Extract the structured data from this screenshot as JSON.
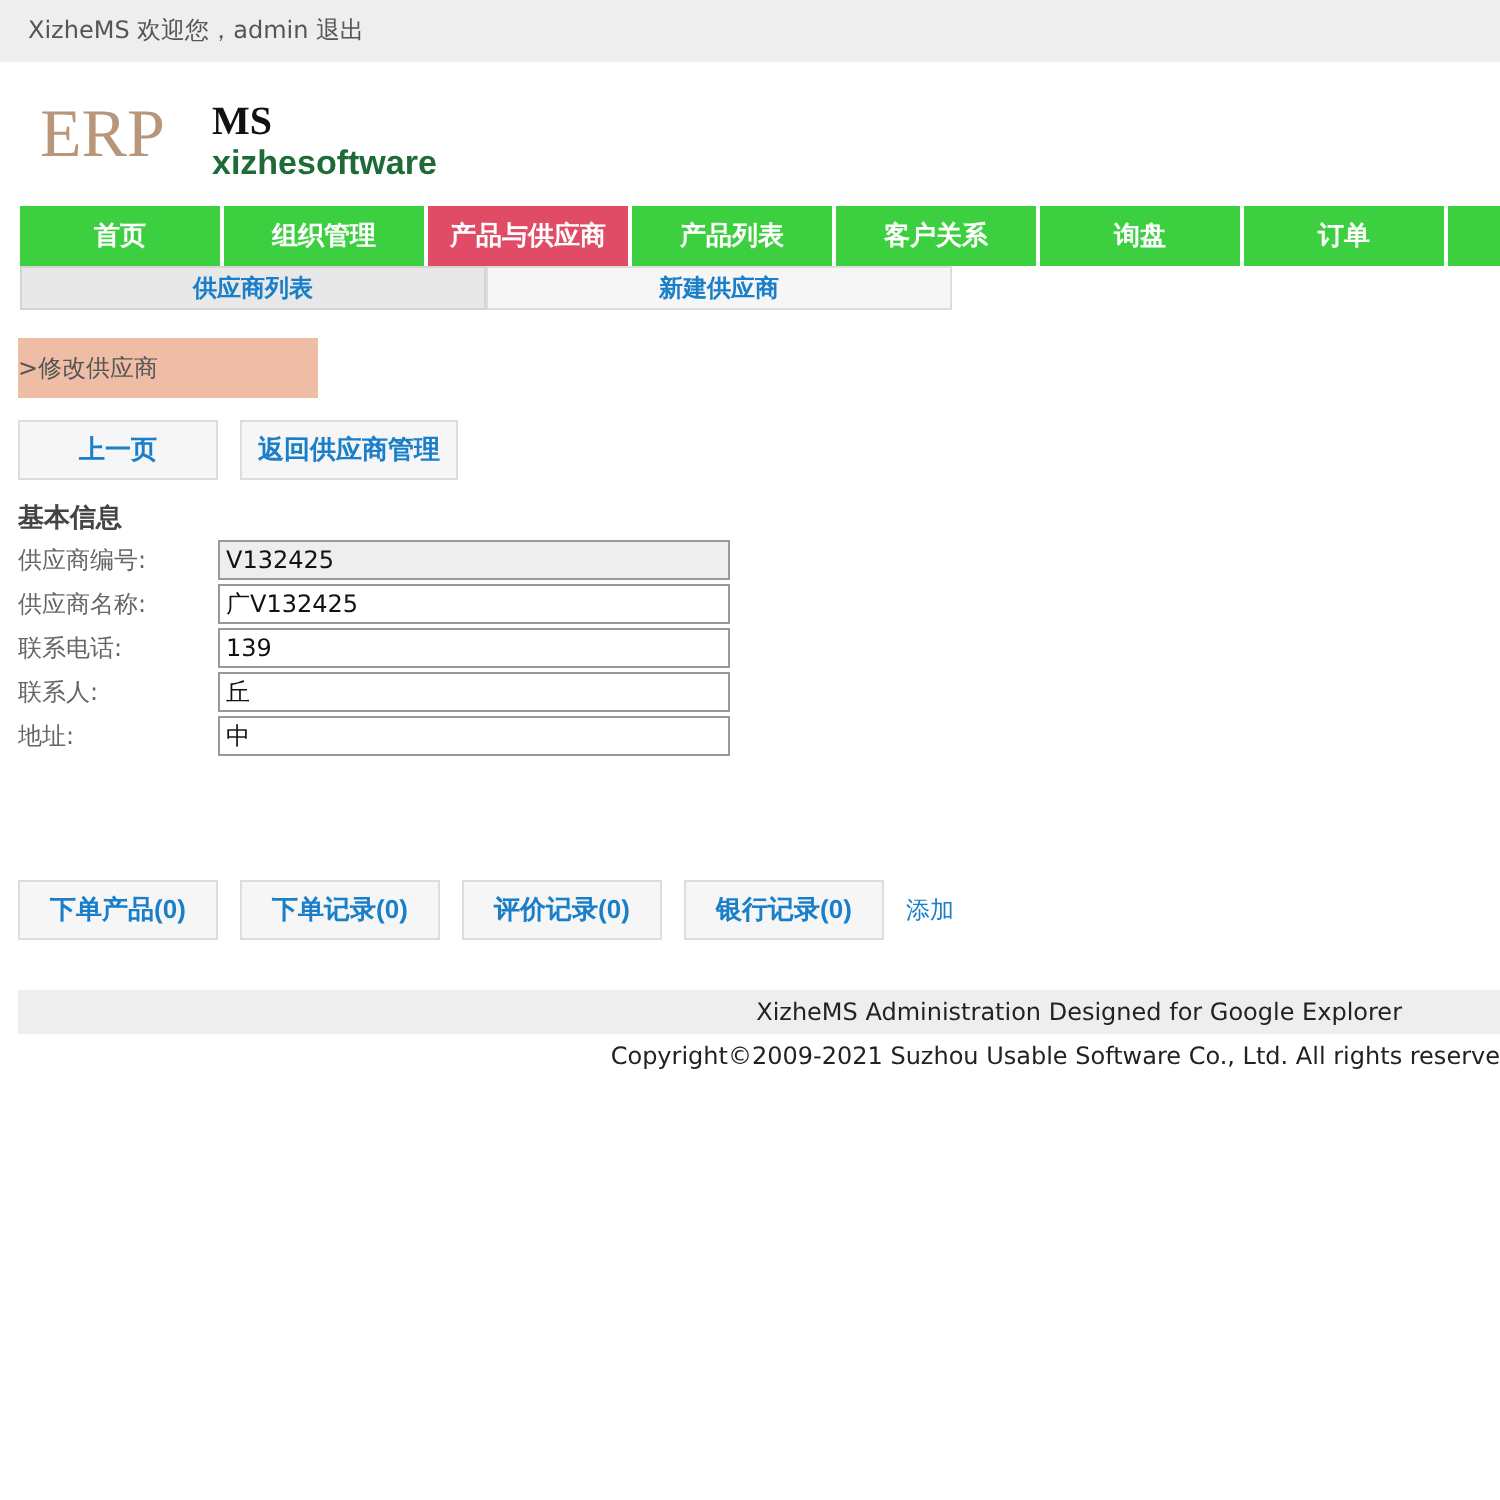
{
  "top_bar": {
    "text": "XizheMS 欢迎您，admin",
    "logout": "退出"
  },
  "logo": {
    "left": "ERP",
    "title": "MS",
    "subtitle": "xizhesoftware"
  },
  "nav": [
    {
      "label": "首页",
      "selected": false
    },
    {
      "label": "组织管理",
      "selected": false
    },
    {
      "label": "产品与供应商",
      "selected": true
    },
    {
      "label": "产品列表",
      "selected": false
    },
    {
      "label": "客户关系",
      "selected": false
    },
    {
      "label": "询盘",
      "selected": false
    },
    {
      "label": "订单",
      "selected": false
    }
  ],
  "sub_tabs": [
    {
      "label": "供应商列表",
      "selected": true
    },
    {
      "label": "新建供应商",
      "selected": false
    }
  ],
  "breadcrumb": ">修改供应商",
  "actions": [
    "上一页",
    "返回供应商管理"
  ],
  "section_title": "基本信息",
  "fields": [
    {
      "label": "供应商编号:",
      "value": "V132425",
      "disabled": true
    },
    {
      "label": "供应商名称:",
      "value": "广V132425",
      "disabled": false
    },
    {
      "label": "联系电话:",
      "value": "139",
      "disabled": false
    },
    {
      "label": "联系人:",
      "value": "丘",
      "disabled": false
    },
    {
      "label": "地址:",
      "value": "中",
      "disabled": false
    }
  ],
  "record_buttons": [
    "下单产品(0)",
    "下单记录(0)",
    "评价记录(0)",
    "银行记录(0)"
  ],
  "add_link": "添加",
  "footer": {
    "designed": "XizheMS Administration Designed for Google Explorer",
    "copyright": "Copyright©2009-2021 Suzhou Usable Software Co., Ltd. All rights reserve"
  }
}
